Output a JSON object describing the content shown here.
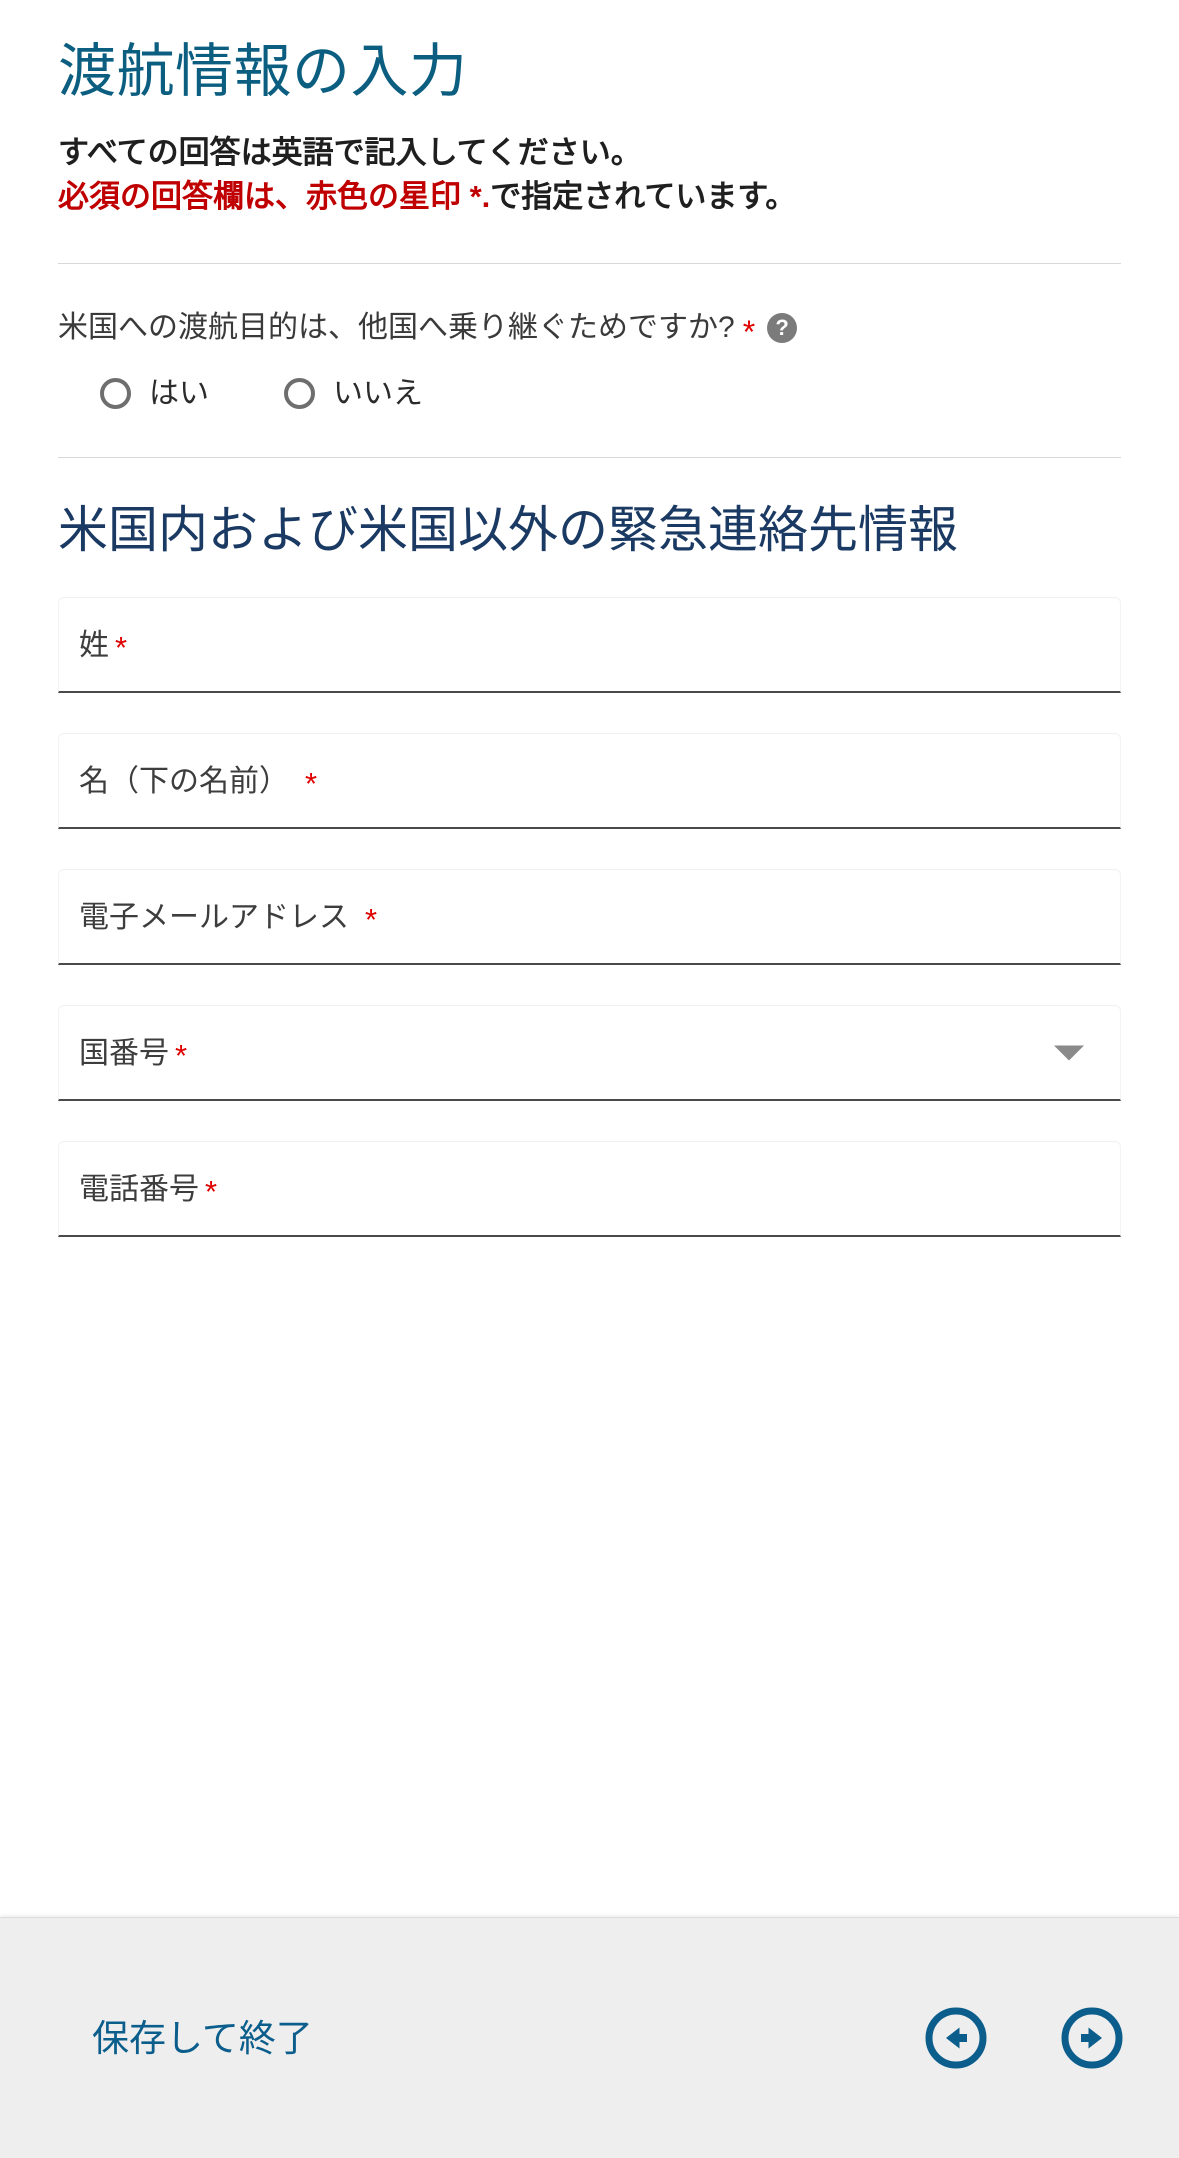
{
  "page": {
    "title": "渡航情報の入力",
    "intro_line1": "すべての回答は英語で記入してください。",
    "intro_line2_red": "必須の回答欄は、赤色の星印 *.",
    "intro_line2_tail": "で指定されています。"
  },
  "transit_question": {
    "text": "米国への渡航目的は、他国へ乗り継ぐためですか?",
    "required_marker": "*",
    "help_icon": "help-question-icon",
    "help_glyph": "?",
    "options": [
      {
        "label": "はい",
        "selected": false
      },
      {
        "label": "いいえ",
        "selected": false
      }
    ]
  },
  "emergency_section": {
    "heading": "米国内および米国以外の緊急連絡先情報",
    "fields": [
      {
        "name": "family-name",
        "label": "姓",
        "required": true,
        "value": "",
        "type": "text"
      },
      {
        "name": "given-name",
        "label": "名（下の名前）",
        "required": true,
        "value": "",
        "type": "text"
      },
      {
        "name": "email-address",
        "label": "電子メールアドレス",
        "required": true,
        "value": "",
        "type": "email"
      },
      {
        "name": "country-code",
        "label": "国番号",
        "required": true,
        "value": "",
        "type": "select"
      },
      {
        "name": "phone-number",
        "label": "電話番号",
        "required": true,
        "value": "",
        "type": "tel"
      }
    ],
    "required_marker": "*"
  },
  "footer": {
    "save_exit_label": "保存して終了",
    "back_icon": "arrow-left-circle-icon",
    "next_icon": "arrow-right-circle-icon"
  },
  "colors": {
    "title_blue": "#0b5e80",
    "heading_navy": "#1b3a63",
    "required_red": "#e00000",
    "warning_red": "#c00000",
    "footer_bg": "#eeeeee",
    "nav_blue": "#0b5e8c",
    "help_gray": "#7b7b7b"
  }
}
